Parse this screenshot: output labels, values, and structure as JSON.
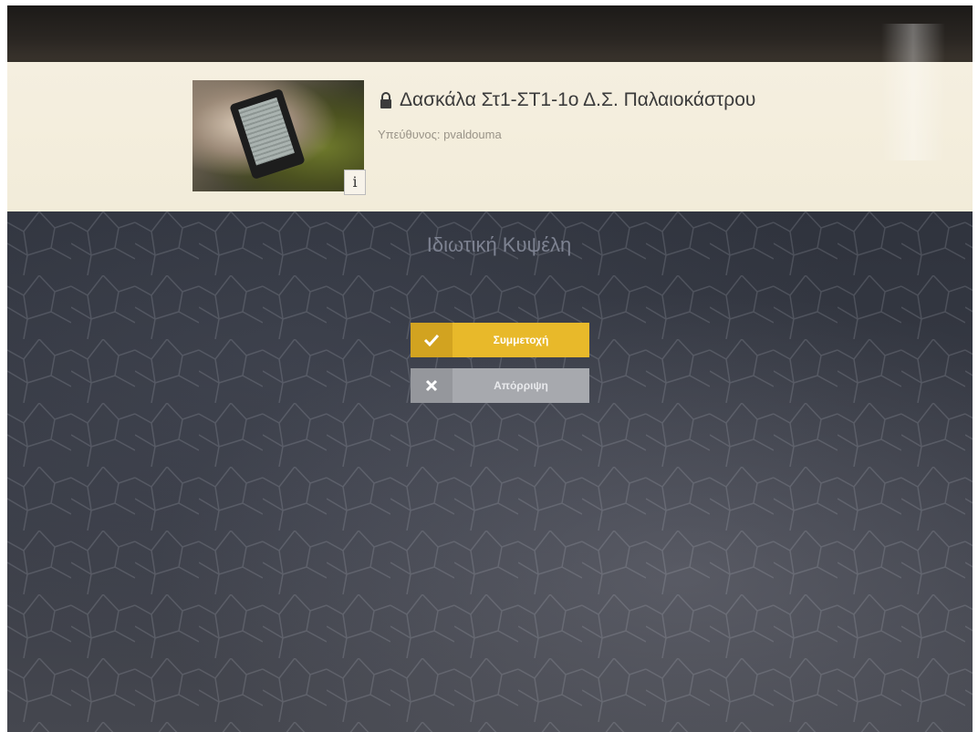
{
  "header": {
    "hive_title": "Δασκάλα Στ1-ΣΤ1-1ο Δ.Σ. Παλαιοκάστρου",
    "owner_label": "Υπεύθυνος: pvaldouma",
    "info_badge": "i",
    "lock_icon": "lock-icon"
  },
  "main": {
    "hive_type": "Ιδιωτική Κυψέλη",
    "accept_label": "Συμμετοχή",
    "reject_label": "Απόρριψη",
    "accept_icon": "check-icon",
    "reject_icon": "x-icon"
  },
  "colors": {
    "accent": "#e8b92a",
    "header_bg": "#f5efe0",
    "content_bg": "#2f333d",
    "reject_bg": "#a7a9ae"
  }
}
